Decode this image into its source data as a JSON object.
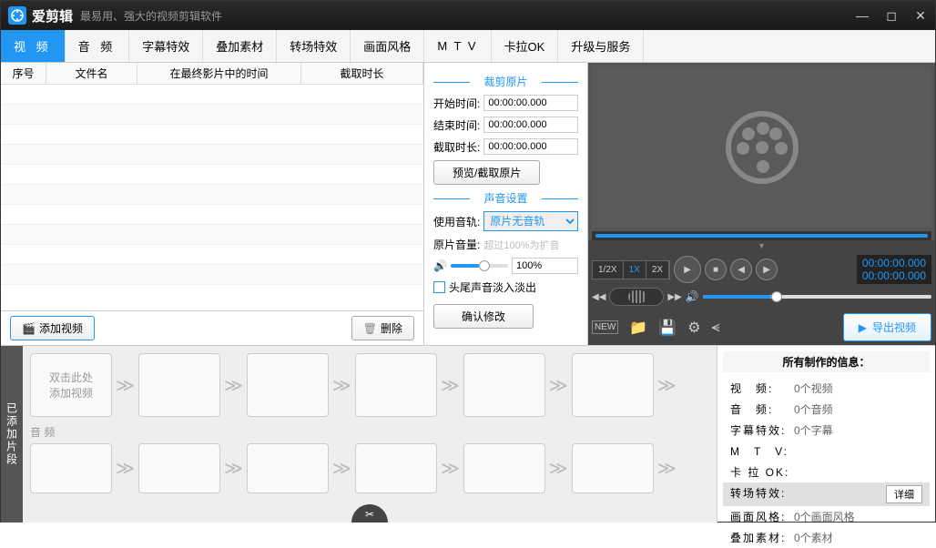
{
  "app": {
    "title": "爱剪辑",
    "subtitle": "最易用、强大的视频剪辑软件"
  },
  "tabs": [
    "视 频",
    "音 频",
    "字幕特效",
    "叠加素材",
    "转场特效",
    "画面风格",
    "M T V",
    "卡拉OK",
    "升级与服务"
  ],
  "table": {
    "cols": [
      "序号",
      "文件名",
      "在最终影片中的时间",
      "截取时长"
    ]
  },
  "toolbar": {
    "add": "添加视频",
    "delete": "删除"
  },
  "crop": {
    "title": "裁剪原片",
    "start_label": "开始时间:",
    "start": "00:00:00.000",
    "end_label": "结束时间:",
    "end": "00:00:00.000",
    "dur_label": "截取时长:",
    "dur": "00:00:00.000",
    "preview_btn": "预览/截取原片"
  },
  "audio": {
    "title": "声音设置",
    "track_label": "使用音轨:",
    "track": "原片无音轨",
    "vol_label": "原片音量:",
    "hint": "超过100%为扩音",
    "vol_value": "100%",
    "fade": "头尾声音淡入淡出",
    "confirm": "确认修改"
  },
  "speeds": [
    "1/2X",
    "1X",
    "2X"
  ],
  "time": {
    "current": "00:00:00.000",
    "total": "00:00:00.000"
  },
  "export": "导出视频",
  "timeline": {
    "vtab": "已添加片段",
    "placeholder1": "双击此处",
    "placeholder2": "添加视频",
    "audio_label": "音 频"
  },
  "info": {
    "title": "所有制作的信息：",
    "rows": [
      {
        "k": "视　频:",
        "v": "0个视频"
      },
      {
        "k": "音　频:",
        "v": "0个音频"
      },
      {
        "k": "字幕特效:",
        "v": "0个字幕"
      },
      {
        "k": "M　T　V:",
        "v": ""
      },
      {
        "k": "卡 拉 OK:",
        "v": ""
      },
      {
        "k": "转场特效:",
        "v": "",
        "detail": "详细"
      },
      {
        "k": "画面风格:",
        "v": "0个画面风格"
      },
      {
        "k": "叠加素材:",
        "v": "0个素材"
      }
    ]
  }
}
